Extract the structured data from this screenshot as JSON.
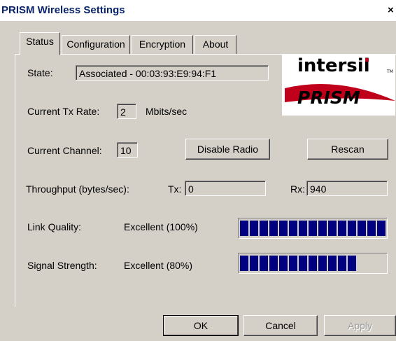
{
  "window": {
    "title": "PRISM Wireless Settings",
    "close_label": "×"
  },
  "tabs": [
    {
      "label": "Status",
      "active": true
    },
    {
      "label": "Configuration",
      "active": false
    },
    {
      "label": "Encryption",
      "active": false
    },
    {
      "label": "About",
      "active": false
    }
  ],
  "status": {
    "state_label": "State:",
    "state_value": "Associated - 00:03:93:E9:94:F1",
    "tx_rate_label": "Current Tx Rate:",
    "tx_rate_value": "2",
    "tx_rate_unit": "Mbits/sec",
    "channel_label": "Current Channel:",
    "channel_value": "10",
    "disable_radio_label": "Disable Radio",
    "rescan_label": "Rescan",
    "throughput_label": "Throughput (bytes/sec):",
    "tx_label": "Tx:",
    "tx_value": "0",
    "rx_label": "Rx:",
    "rx_value": "940",
    "link_quality_label": "Link Quality:",
    "link_quality_value": "Excellent (100%)",
    "link_quality_percent": 100,
    "signal_strength_label": "Signal Strength:",
    "signal_strength_value": "Excellent (80%)",
    "signal_strength_percent": 80
  },
  "logo": {
    "brand": "intersil",
    "tm": "TM",
    "product": "PRISM",
    "accent_color": "#c0001a"
  },
  "footer": {
    "ok_label": "OK",
    "cancel_label": "Cancel",
    "apply_label": "Apply"
  },
  "colors": {
    "bar_fill": "#000080",
    "title_text": "#0a246a"
  }
}
